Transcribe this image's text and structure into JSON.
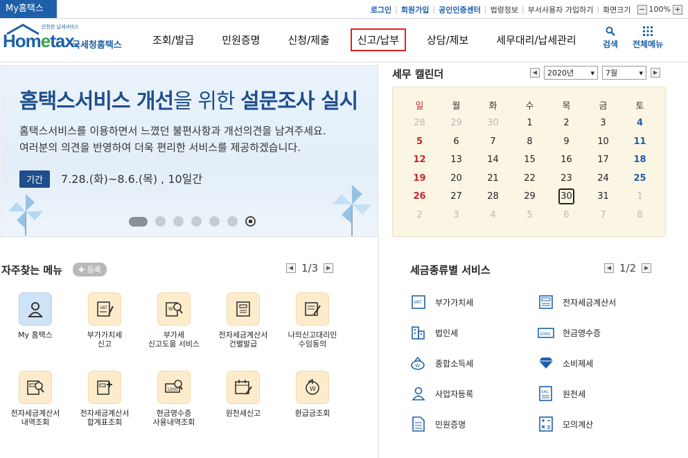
{
  "top": {
    "badge": "My홈택스",
    "links": [
      "로그인",
      "회원가입",
      "공인인증센터",
      "법령정보",
      "부서사용자 가입하기",
      "화면크기"
    ],
    "zoom": "100%"
  },
  "logo": {
    "small": "안전한 납세서비스",
    "word_h": "Hom",
    "word_e": "e",
    "word_t": "tax.",
    "kr": "국세청홈택스"
  },
  "nav": [
    "조회/발급",
    "민원증명",
    "신청/제출",
    "신고/납부",
    "상담/제보",
    "세무대리/납세관리"
  ],
  "tools": {
    "search": "검색",
    "menu": "전체메뉴"
  },
  "banner": {
    "title_a": "홈택스서비스 개선",
    "title_b": "을 위한 ",
    "title_c": "설문조사 실시",
    "line1": "홈택스서비스를 이용하면서 느꼈던 불편사항과 개선의견을 남겨주세요.",
    "line2": "여러분의 의견을 반영하여 더욱 편리한 서비스를 제공하겠습니다.",
    "tag": "기간",
    "period": "7.28.(화)~8.6.(목) , 10일간"
  },
  "calendar": {
    "title": "세무 캘린더",
    "year": "2020년",
    "month": "7월",
    "weekdays": [
      "일",
      "월",
      "화",
      "수",
      "목",
      "금",
      "토"
    ],
    "weeks": [
      [
        "28",
        "29",
        "30",
        "1",
        "2",
        "3",
        "4"
      ],
      [
        "5",
        "6",
        "7",
        "8",
        "9",
        "10",
        "11"
      ],
      [
        "12",
        "13",
        "14",
        "15",
        "16",
        "17",
        "18"
      ],
      [
        "19",
        "20",
        "21",
        "22",
        "23",
        "24",
        "25"
      ],
      [
        "26",
        "27",
        "28",
        "29",
        "30",
        "31",
        "1"
      ],
      [
        "2",
        "3",
        "4",
        "5",
        "6",
        "7",
        "8"
      ]
    ]
  },
  "favorites": {
    "title": "자주찾는 메뉴",
    "add": "등록",
    "page": "1/3",
    "items": [
      {
        "l1": "My 홈택스",
        "l2": ""
      },
      {
        "l1": "부가가치세",
        "l2": "신고"
      },
      {
        "l1": "부가세",
        "l2": "신고도움 서비스"
      },
      {
        "l1": "전자세금계산서",
        "l2": "건별발급"
      },
      {
        "l1": "나의신고대리인",
        "l2": "수임동의"
      },
      {
        "l1": "전자세금계산서",
        "l2": "내역조회"
      },
      {
        "l1": "전자세금계산서",
        "l2": "합계표조회"
      },
      {
        "l1": "현금영수증",
        "l2": "사용내역조회"
      },
      {
        "l1": "원천세신고",
        "l2": ""
      },
      {
        "l1": "환급금조회",
        "l2": ""
      }
    ]
  },
  "tax_services": {
    "title": "세금종류별 서비스",
    "page": "1/2",
    "items": [
      "부가가치세",
      "전자세금계산서",
      "법인세",
      "현금영수증",
      "종합소득세",
      "소비제세",
      "사업자등록",
      "원천세",
      "민원증명",
      "모의계산"
    ]
  }
}
